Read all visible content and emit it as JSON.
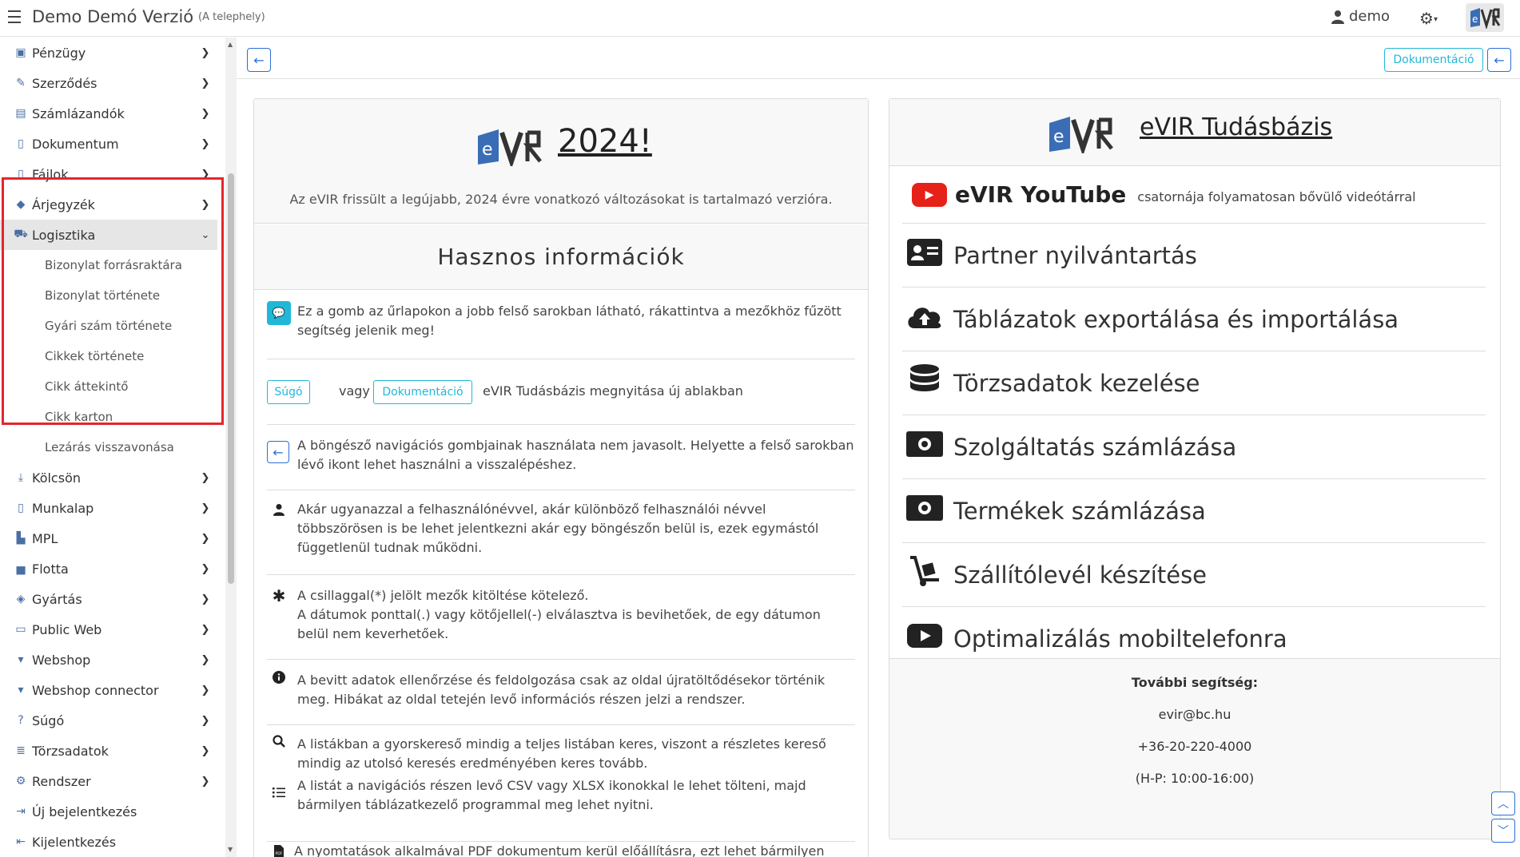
{
  "header": {
    "title": "Demo Demó Verzió",
    "subtitle": "(A telephely)",
    "user": "demo",
    "logo_text": "eVIR"
  },
  "sidebar": {
    "items": [
      {
        "label": "Pénzügy",
        "icon": "money-icon"
      },
      {
        "label": "Szerződés",
        "icon": "contract-icon"
      },
      {
        "label": "Számlázandók",
        "icon": "invoice-icon"
      },
      {
        "label": "Dokumentum",
        "icon": "document-icon"
      },
      {
        "label": "Fájlok",
        "icon": "file-icon"
      },
      {
        "label": "Árjegyzék",
        "icon": "tag-icon"
      },
      {
        "label": "Logisztika",
        "icon": "dolly-icon"
      },
      {
        "label": "Kölcsön",
        "icon": "lend-icon"
      },
      {
        "label": "Munkalap",
        "icon": "worksheet-icon"
      },
      {
        "label": "MPL",
        "icon": "truck-icon"
      },
      {
        "label": "Flotta",
        "icon": "car-icon"
      },
      {
        "label": "Gyártás",
        "icon": "cubes-icon"
      },
      {
        "label": "Public Web",
        "icon": "web-icon"
      },
      {
        "label": "Webshop",
        "icon": "cart-icon"
      },
      {
        "label": "Webshop connector",
        "icon": "cart-icon"
      },
      {
        "label": "Súgó",
        "icon": "help-icon"
      },
      {
        "label": "Törzsadatok",
        "icon": "database-icon"
      },
      {
        "label": "Rendszer",
        "icon": "gears-icon"
      },
      {
        "label": "Új bejelentkezés",
        "icon": "login-icon"
      },
      {
        "label": "Kijelentkezés",
        "icon": "logout-icon"
      }
    ],
    "logistics_sub": [
      "Bizonylat forrásraktára",
      "Bizonylat története",
      "Gyári szám története",
      "Cikkek története",
      "Cikk áttekintő",
      "Cikk karton",
      "Lezárás visszavonása"
    ]
  },
  "toolbar": {
    "doc_label": "Dokumentáció"
  },
  "news": {
    "logo_text": "eVIR",
    "year": "2024!",
    "text": "Az eVIR frissült a legújabb, 2024 évre vonatkozó változásokat is tartalmazó verzióra."
  },
  "useful": {
    "title": "Hasznos információk",
    "help_text": "Ez a gomb az űrlapokon a jobb felső sarokban látható, rákattintva a mezőkhöz fűzött segítség jelenik meg!",
    "sugo_label": "Súgó",
    "or_text": "vagy",
    "doc_label": "Dokumentáció",
    "doc_text": "eVIR Tudásbázis megnyitása új ablakban",
    "back_text": "A böngésző navigációs gombjainak használata nem javasolt. Helyette a felső sarokban lévő ikont lehet használni a visszalépéshez.",
    "user_text": "Akár ugyanazzal a felhasználónévvel, akár különböző felhasználói névvel többszörösen is be lehet jelentkezni akár egy böngészőn belül is, ezek egymástól függetlenül tudnak működni.",
    "star_text1": "A csillaggal(*) jelölt mezők kitöltése kötelező.",
    "star_text2": "A dátumok ponttal(.) vagy kötőjellel(-) elválasztva is bevihetőek, de egy dátumon belül nem keverhetőek.",
    "info_text": "A bevitt adatok ellenőrzése és feldolgozása csak az oldal újratöltődésekor történik meg. Hibákat az oldal tetején levő információs részen jelzi a rendszer.",
    "search_text": "A listákban a gyorskereső mindig a teljes listában keres, viszont a részletes kereső mindig az utolsó keresés eredményében keres tovább.",
    "list_text": "A listát a navigációs részen levő CSV vagy XLSX ikonokkal le lehet tölteni, majd bármilyen táblázatkezelő programmal meg lehet nyitni.",
    "pdf_text": "A nyomtatások alkalmával PDF dokumentum kerül előállításra, ezt lehet bármilyen"
  },
  "knowledge": {
    "logo_text": "eVIR",
    "title": "eVIR Tudásbázis",
    "yt_word": "eVIR YouTube",
    "yt_text": "csatornája folyamatosan bővülő videótárral",
    "items": [
      {
        "label": "Partner nyilvántartás",
        "icon": "id-card-icon"
      },
      {
        "label": "Táblázatok exportálása és importálása",
        "icon": "cloud-upload-icon"
      },
      {
        "label": "Törzsadatok kezelése",
        "icon": "database-icon"
      },
      {
        "label": "Szolgáltatás számlázása",
        "icon": "money-bill-icon"
      },
      {
        "label": "Termékek számlázása",
        "icon": "money-bill-icon"
      },
      {
        "label": "Szállítólevél készítése",
        "icon": "dolly-icon"
      },
      {
        "label": "Optimalizálás mobiltelefonra",
        "icon": "youtube-play-icon"
      }
    ],
    "contact_title": "További segítség:",
    "email": "evir@bc.hu",
    "phone": "+36-20-220-4000",
    "hours": "(H-P: 10:00-16:00)"
  },
  "colors": {
    "accent": "#2a6fd6",
    "info": "#21b8d8",
    "highlight": "#e3262e",
    "youtube": "#e62117"
  }
}
